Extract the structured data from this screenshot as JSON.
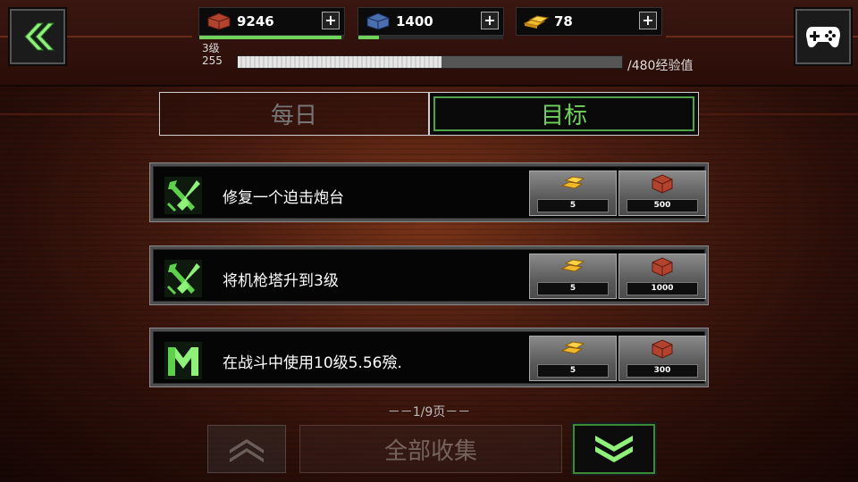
{
  "resources": [
    {
      "name": "red-crate-icon",
      "value": "9246",
      "plus": "+",
      "fill": 0.98
    },
    {
      "name": "blue-crate-icon",
      "value": "1400",
      "plus": "+",
      "fill": 0.14
    },
    {
      "name": "gold-bars-icon",
      "value": "78",
      "plus": "+",
      "fill": 0
    }
  ],
  "level": {
    "label": "3级",
    "points": "255",
    "xp_max": "/480经验值",
    "xp_fraction": 0.53
  },
  "tabs": {
    "daily": "每日",
    "goal": "目标"
  },
  "missions": [
    {
      "text": "修复一个迫击炮台",
      "icon": "wrench-screwdriver-icon",
      "gold": "5",
      "crates": "500"
    },
    {
      "text": "将机枪塔升到3级",
      "icon": "wrench-screwdriver-icon",
      "gold": "5",
      "crates": "1000"
    },
    {
      "text": "在战斗中使用10级5.56殮.",
      "icon": "ammo-emblem-icon",
      "gold": "5",
      "crates": "300"
    }
  ],
  "pagination": "－－1/9页－－",
  "buttons": {
    "collect_all": "全部收集"
  },
  "colors": {
    "accent": "#6fd35b",
    "background": "#4a1c10"
  }
}
